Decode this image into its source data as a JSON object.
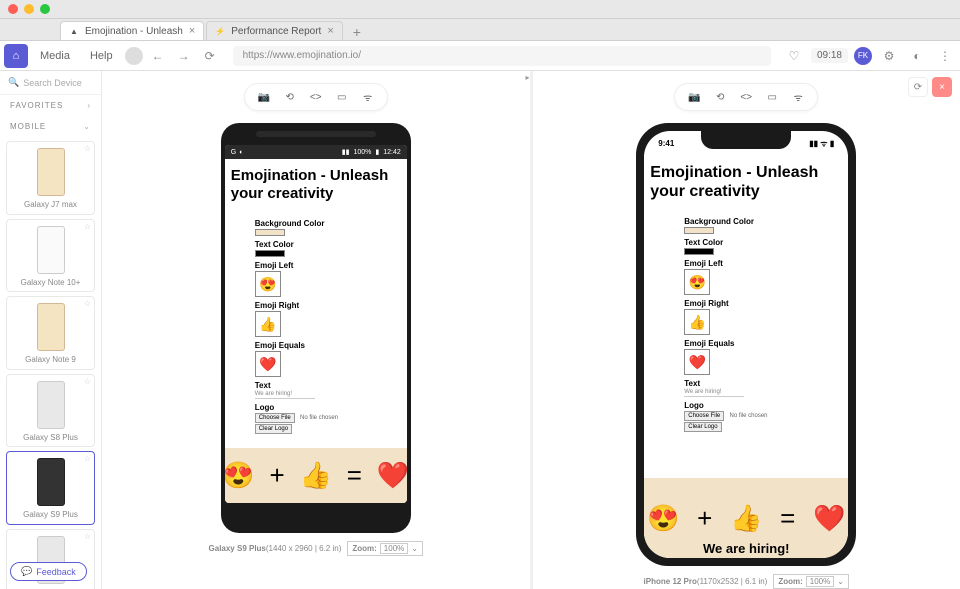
{
  "tabs": [
    {
      "label": "Emojination - Unleash",
      "icon": "▲"
    },
    {
      "label": "Performance Report",
      "icon": "⚡"
    }
  ],
  "toolbar": {
    "media": "Media",
    "help": "Help",
    "url": "https://www.emojination.io/",
    "time": "09:18",
    "user_initials": "FK"
  },
  "sidebar": {
    "search_placeholder": "Search Device",
    "favorites": "FAVORITES",
    "mobile": "MOBILE",
    "devices": [
      {
        "name": "Galaxy J7 max",
        "thumb": "gold"
      },
      {
        "name": "Galaxy Note 10+",
        "thumb": "white"
      },
      {
        "name": "Galaxy Note 9",
        "thumb": "gold"
      },
      {
        "name": "Galaxy S8 Plus",
        "thumb": "silver"
      },
      {
        "name": "Galaxy S9 Plus",
        "thumb": "dark",
        "selected": true
      },
      {
        "name": "",
        "thumb": "silver"
      }
    ]
  },
  "feedback": "Feedback",
  "app": {
    "title": "Emojination - Unleash your creativity",
    "labels": {
      "bg": "Background Color",
      "text_color": "Text Color",
      "emoji_left": "Emoji Left",
      "emoji_right": "Emoji Right",
      "emoji_equals": "Emoji Equals",
      "text": "Text",
      "logo": "Logo"
    },
    "text_value": "We are hiring!",
    "choose_file": "Choose File",
    "no_file": "No file chosen",
    "clear_logo": "Clear Logo",
    "emojis": {
      "left": "😍",
      "right": "👍",
      "equals": "❤️"
    },
    "hiring": "We are hiring!"
  },
  "android": {
    "statusbar": {
      "signal": "📶",
      "battery": "100%",
      "time": "12:42"
    },
    "caption_name": "Galaxy S9 Plus",
    "caption_dims": "(1440 x 2960 | 6.2 in)"
  },
  "iphone": {
    "statusbar": {
      "time": "9:41"
    },
    "caption_name": "iPhone 12 Pro",
    "caption_dims": "(1170x2532 | 6.1 in)"
  },
  "zoom": {
    "label": "Zoom:",
    "value": "100%"
  }
}
